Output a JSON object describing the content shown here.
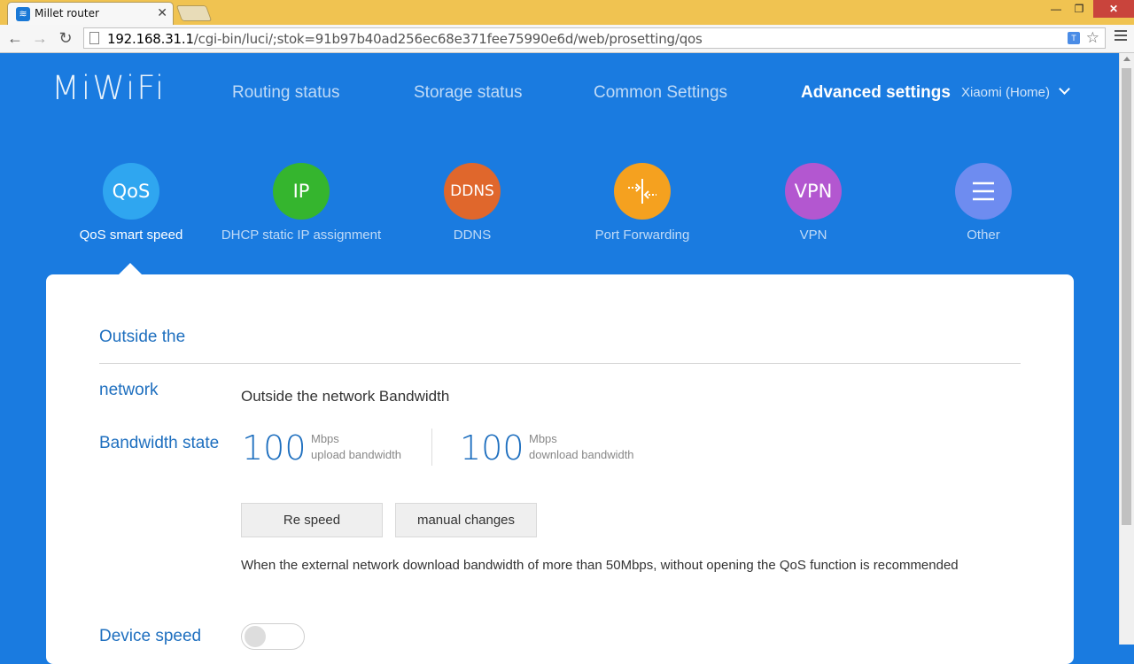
{
  "browser": {
    "tab_title": "Millet router",
    "tab_close": "✕",
    "url_host": "192.168.31.1",
    "url_path": "/cgi-bin/luci/;stok=91b97b40ad256ec68e371fee75990e6d/web/prosetting/qos"
  },
  "header": {
    "logo": "MiWiFi",
    "nav": [
      "Routing status",
      "Storage status",
      "Common Settings",
      "Advanced settings"
    ],
    "active_nav": "Advanced settings",
    "user": "Xiaomi (Home)"
  },
  "features": [
    {
      "icon_text": "QoS",
      "label": "QoS smart speed",
      "color": "#2fa6f0",
      "icon": "qos-icon"
    },
    {
      "icon_text": "IP",
      "label": "DHCP static IP assignment",
      "color": "#35b52e",
      "icon": "ip-icon"
    },
    {
      "icon_text": "DDNS",
      "label": "DDNS",
      "color": "#e0672c",
      "icon": "ddns-icon"
    },
    {
      "icon_text": "",
      "label": "Port Forwarding",
      "color": "#f5a11f",
      "icon": "port-forward-icon"
    },
    {
      "icon_text": "VPN",
      "label": "VPN",
      "color": "#b357d0",
      "icon": "vpn-icon"
    },
    {
      "icon_text": "",
      "label": "Other",
      "color": "#6e8cf0",
      "icon": "menu-icon"
    }
  ],
  "panel": {
    "labels": [
      "Outside the",
      "network",
      "Bandwidth state",
      "Device speed"
    ],
    "bandwidth_title": "Outside the network Bandwidth",
    "upload": {
      "value": "100",
      "unit": "Mbps",
      "label": "upload bandwidth"
    },
    "download": {
      "value": "100",
      "unit": "Mbps",
      "label": "download bandwidth"
    },
    "buttons": [
      "Re speed",
      "manual changes"
    ],
    "notice": "When the external network download bandwidth of more than 50Mbps, without opening the QoS function is recommended",
    "device_speed_enabled": false
  },
  "colors": {
    "brand_blue": "#1a7be0",
    "accent_text": "#1e6fbf"
  }
}
